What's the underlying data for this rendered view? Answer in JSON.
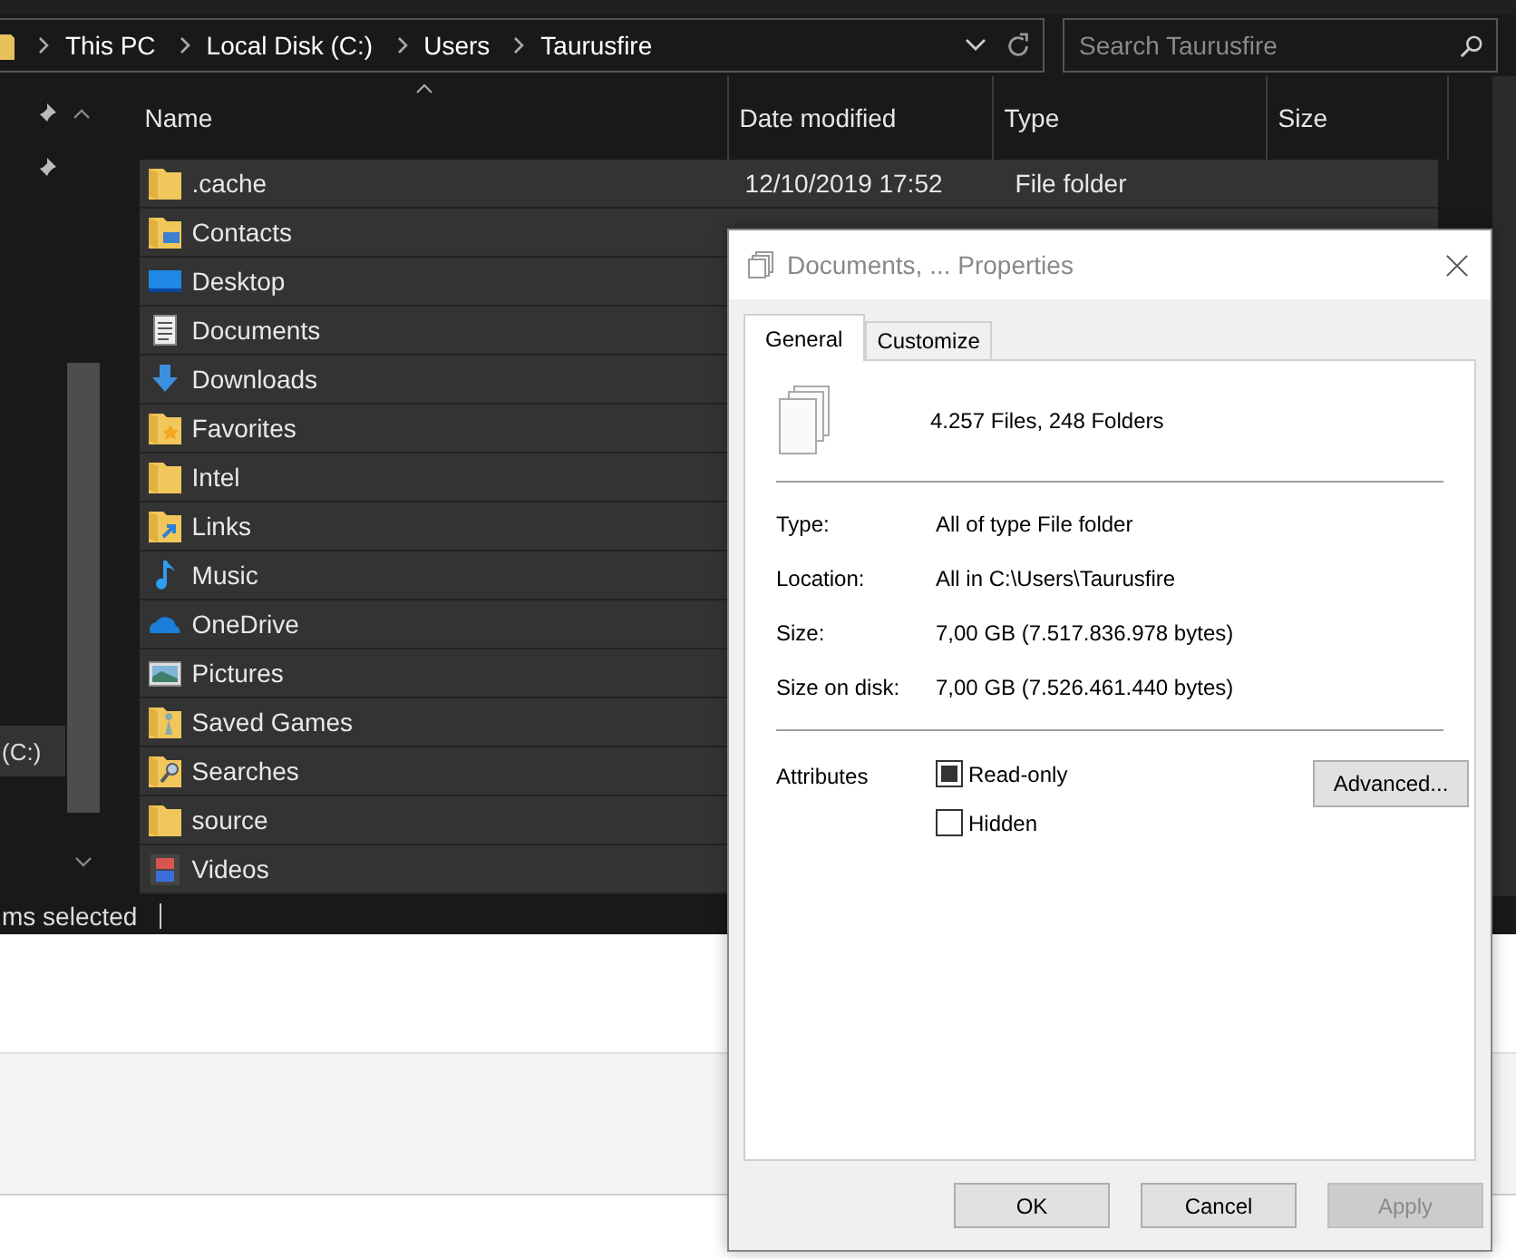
{
  "address_bar": {
    "breadcrumbs": [
      "This PC",
      "Local Disk (C:)",
      "Users",
      "Taurusfire"
    ]
  },
  "search": {
    "placeholder": "Search Taurusfire"
  },
  "nav_pane": {
    "items": [
      {
        "label": "(C:)",
        "selected": true
      }
    ]
  },
  "file_list": {
    "columns": [
      "Name",
      "Date modified",
      "Type",
      "Size"
    ],
    "rows": [
      {
        "name": ".cache",
        "kind": "folder",
        "date": "12/10/2019 17:52",
        "type": "File folder",
        "selected": true
      },
      {
        "name": "Contacts",
        "kind": "contacts",
        "selected": true
      },
      {
        "name": "Desktop",
        "kind": "desktop",
        "selected": true
      },
      {
        "name": "Documents",
        "kind": "documents",
        "selected": true
      },
      {
        "name": "Downloads",
        "kind": "downloads",
        "selected": true
      },
      {
        "name": "Favorites",
        "kind": "favorites",
        "selected": true
      },
      {
        "name": "Intel",
        "kind": "folder",
        "selected": true
      },
      {
        "name": "Links",
        "kind": "links",
        "selected": true
      },
      {
        "name": "Music",
        "kind": "music",
        "selected": true
      },
      {
        "name": "OneDrive",
        "kind": "onedrive",
        "selected": true
      },
      {
        "name": "Pictures",
        "kind": "pictures",
        "selected": true
      },
      {
        "name": "Saved Games",
        "kind": "games",
        "selected": true
      },
      {
        "name": "Searches",
        "kind": "searches",
        "selected": true
      },
      {
        "name": "source",
        "kind": "folder",
        "selected": true
      },
      {
        "name": "Videos",
        "kind": "videos",
        "selected": true
      }
    ]
  },
  "status_bar": {
    "text": "ms selected"
  },
  "dialog": {
    "title": "Documents, ... Properties",
    "tabs": [
      {
        "label": "General",
        "selected": true
      },
      {
        "label": "Customize",
        "selected": false
      }
    ],
    "summary": "4.257 Files, 248 Folders",
    "properties": [
      {
        "label": "Type:",
        "value": "All of type File folder"
      },
      {
        "label": "Location:",
        "value": "All in C:\\Users\\Taurusfire"
      },
      {
        "label": "Size:",
        "value": "7,00 GB (7.517.836.978 bytes)"
      },
      {
        "label": "Size on disk:",
        "value": "7,00 GB (7.526.461.440 bytes)"
      }
    ],
    "attributes": {
      "label": "Attributes",
      "options": [
        {
          "label": "Read-only",
          "indeterminate": true
        },
        {
          "label": "Hidden",
          "indeterminate": false
        }
      ],
      "advanced_button": "Advanced..."
    },
    "buttons": [
      {
        "label": "OK",
        "disabled": false
      },
      {
        "label": "Cancel",
        "disabled": false
      },
      {
        "label": "Apply",
        "disabled": true
      }
    ]
  }
}
